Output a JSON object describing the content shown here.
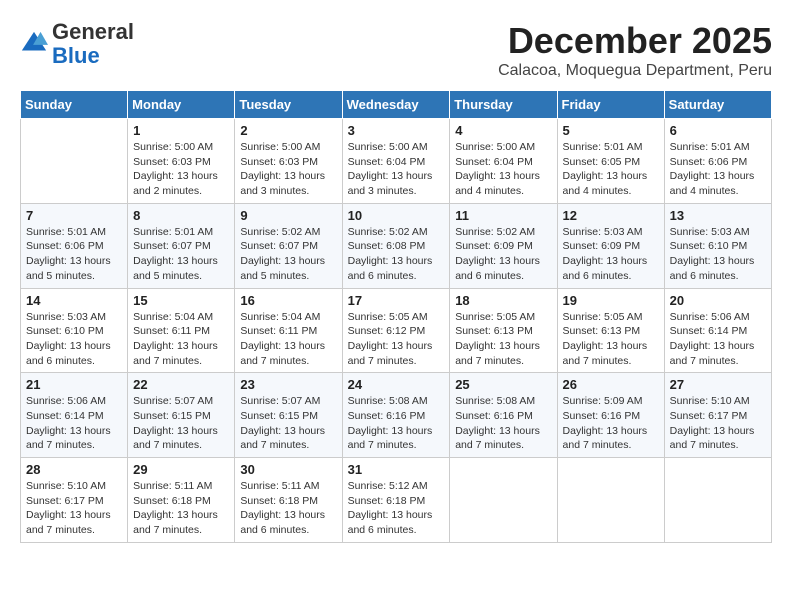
{
  "logo": {
    "general": "General",
    "blue": "Blue"
  },
  "header": {
    "month": "December 2025",
    "location": "Calacoa, Moquegua Department, Peru"
  },
  "weekdays": [
    "Sunday",
    "Monday",
    "Tuesday",
    "Wednesday",
    "Thursday",
    "Friday",
    "Saturday"
  ],
  "weeks": [
    [
      {
        "day": "",
        "content": ""
      },
      {
        "day": "1",
        "content": "Sunrise: 5:00 AM\nSunset: 6:03 PM\nDaylight: 13 hours\nand 2 minutes."
      },
      {
        "day": "2",
        "content": "Sunrise: 5:00 AM\nSunset: 6:03 PM\nDaylight: 13 hours\nand 3 minutes."
      },
      {
        "day": "3",
        "content": "Sunrise: 5:00 AM\nSunset: 6:04 PM\nDaylight: 13 hours\nand 3 minutes."
      },
      {
        "day": "4",
        "content": "Sunrise: 5:00 AM\nSunset: 6:04 PM\nDaylight: 13 hours\nand 4 minutes."
      },
      {
        "day": "5",
        "content": "Sunrise: 5:01 AM\nSunset: 6:05 PM\nDaylight: 13 hours\nand 4 minutes."
      },
      {
        "day": "6",
        "content": "Sunrise: 5:01 AM\nSunset: 6:06 PM\nDaylight: 13 hours\nand 4 minutes."
      }
    ],
    [
      {
        "day": "7",
        "content": "Sunrise: 5:01 AM\nSunset: 6:06 PM\nDaylight: 13 hours\nand 5 minutes."
      },
      {
        "day": "8",
        "content": "Sunrise: 5:01 AM\nSunset: 6:07 PM\nDaylight: 13 hours\nand 5 minutes."
      },
      {
        "day": "9",
        "content": "Sunrise: 5:02 AM\nSunset: 6:07 PM\nDaylight: 13 hours\nand 5 minutes."
      },
      {
        "day": "10",
        "content": "Sunrise: 5:02 AM\nSunset: 6:08 PM\nDaylight: 13 hours\nand 6 minutes."
      },
      {
        "day": "11",
        "content": "Sunrise: 5:02 AM\nSunset: 6:09 PM\nDaylight: 13 hours\nand 6 minutes."
      },
      {
        "day": "12",
        "content": "Sunrise: 5:03 AM\nSunset: 6:09 PM\nDaylight: 13 hours\nand 6 minutes."
      },
      {
        "day": "13",
        "content": "Sunrise: 5:03 AM\nSunset: 6:10 PM\nDaylight: 13 hours\nand 6 minutes."
      }
    ],
    [
      {
        "day": "14",
        "content": "Sunrise: 5:03 AM\nSunset: 6:10 PM\nDaylight: 13 hours\nand 6 minutes."
      },
      {
        "day": "15",
        "content": "Sunrise: 5:04 AM\nSunset: 6:11 PM\nDaylight: 13 hours\nand 7 minutes."
      },
      {
        "day": "16",
        "content": "Sunrise: 5:04 AM\nSunset: 6:11 PM\nDaylight: 13 hours\nand 7 minutes."
      },
      {
        "day": "17",
        "content": "Sunrise: 5:05 AM\nSunset: 6:12 PM\nDaylight: 13 hours\nand 7 minutes."
      },
      {
        "day": "18",
        "content": "Sunrise: 5:05 AM\nSunset: 6:13 PM\nDaylight: 13 hours\nand 7 minutes."
      },
      {
        "day": "19",
        "content": "Sunrise: 5:05 AM\nSunset: 6:13 PM\nDaylight: 13 hours\nand 7 minutes."
      },
      {
        "day": "20",
        "content": "Sunrise: 5:06 AM\nSunset: 6:14 PM\nDaylight: 13 hours\nand 7 minutes."
      }
    ],
    [
      {
        "day": "21",
        "content": "Sunrise: 5:06 AM\nSunset: 6:14 PM\nDaylight: 13 hours\nand 7 minutes."
      },
      {
        "day": "22",
        "content": "Sunrise: 5:07 AM\nSunset: 6:15 PM\nDaylight: 13 hours\nand 7 minutes."
      },
      {
        "day": "23",
        "content": "Sunrise: 5:07 AM\nSunset: 6:15 PM\nDaylight: 13 hours\nand 7 minutes."
      },
      {
        "day": "24",
        "content": "Sunrise: 5:08 AM\nSunset: 6:16 PM\nDaylight: 13 hours\nand 7 minutes."
      },
      {
        "day": "25",
        "content": "Sunrise: 5:08 AM\nSunset: 6:16 PM\nDaylight: 13 hours\nand 7 minutes."
      },
      {
        "day": "26",
        "content": "Sunrise: 5:09 AM\nSunset: 6:16 PM\nDaylight: 13 hours\nand 7 minutes."
      },
      {
        "day": "27",
        "content": "Sunrise: 5:10 AM\nSunset: 6:17 PM\nDaylight: 13 hours\nand 7 minutes."
      }
    ],
    [
      {
        "day": "28",
        "content": "Sunrise: 5:10 AM\nSunset: 6:17 PM\nDaylight: 13 hours\nand 7 minutes."
      },
      {
        "day": "29",
        "content": "Sunrise: 5:11 AM\nSunset: 6:18 PM\nDaylight: 13 hours\nand 7 minutes."
      },
      {
        "day": "30",
        "content": "Sunrise: 5:11 AM\nSunset: 6:18 PM\nDaylight: 13 hours\nand 6 minutes."
      },
      {
        "day": "31",
        "content": "Sunrise: 5:12 AM\nSunset: 6:18 PM\nDaylight: 13 hours\nand 6 minutes."
      },
      {
        "day": "",
        "content": ""
      },
      {
        "day": "",
        "content": ""
      },
      {
        "day": "",
        "content": ""
      }
    ]
  ]
}
